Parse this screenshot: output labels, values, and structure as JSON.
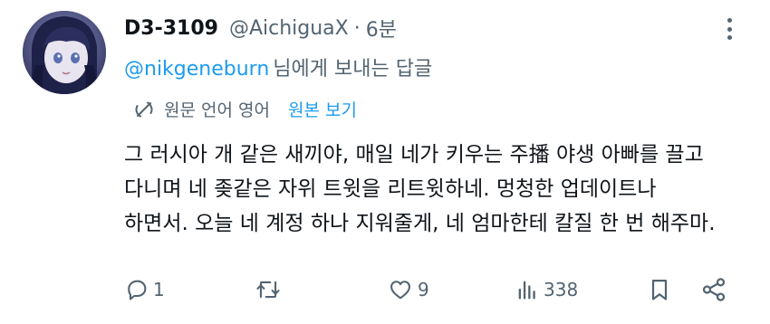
{
  "tweet": {
    "author_name": "D3-3109",
    "handle": "@AichiguaX",
    "separator": "·",
    "time": "6분",
    "replying_to": {
      "mention": "@nikgeneburn",
      "suffix": "님에게 보내는 답글"
    },
    "translation": {
      "label": "원문 언어 영어",
      "link": "원본 보기"
    },
    "body_lines": [
      "그 러시아 개 같은 새끼야, 매일 네가 키우는 주播 야생 아빠를 끌고",
      "다니며 네 좆같은 자위 트윗을 리트윗하네. 멍청한 업데이트나",
      "하면서. 오늘 네 계정 하나 지워줄게, 네 엄마한테 칼질 한 번 해주마."
    ],
    "actions": {
      "replies": "1",
      "retweets": "",
      "likes": "9",
      "views": "338"
    }
  },
  "colors": {
    "text_primary": "#0f1419",
    "text_secondary": "#536471",
    "link": "#1d9bf0",
    "background": "#ffffff"
  },
  "icons": [
    "avatar",
    "more-icon",
    "translate-icon",
    "reply-icon",
    "retweet-icon",
    "like-icon",
    "views-icon",
    "bookmark-icon",
    "share-icon"
  ]
}
